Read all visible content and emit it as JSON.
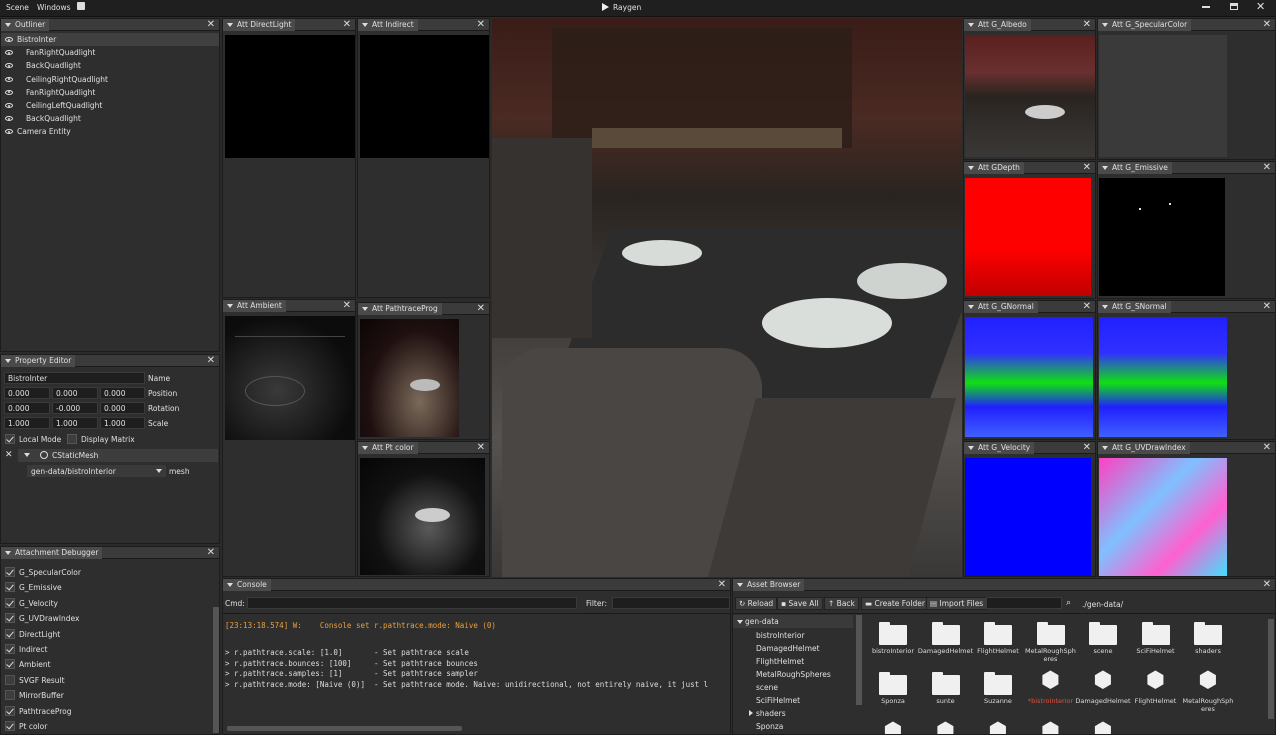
{
  "menu": {
    "scene": "Scene",
    "windows": "Windows",
    "save_icon": "save-icon",
    "run_label": "Raygen"
  },
  "outliner": {
    "title": "Outliner",
    "items": [
      {
        "label": "BistroInter",
        "indent": false,
        "selected": true
      },
      {
        "label": "FanRightQuadlight",
        "indent": true
      },
      {
        "label": "BackQuadlight",
        "indent": true
      },
      {
        "label": "CeilingRightQuadlight",
        "indent": true
      },
      {
        "label": "FanRightQuadlight",
        "indent": true
      },
      {
        "label": "CeilingLeftQuadlight",
        "indent": true
      },
      {
        "label": "BackQuadlight",
        "indent": true
      },
      {
        "label": "Camera Entity",
        "indent": false
      }
    ]
  },
  "property_editor": {
    "title": "Property Editor",
    "name_value": "BistroInter",
    "name_label": "Name",
    "position": [
      "0.000",
      "0.000",
      "0.000"
    ],
    "position_label": "Position",
    "rotation": [
      "0.000",
      "-0.000",
      "0.000"
    ],
    "rotation_label": "Rotation",
    "scale": [
      "1.000",
      "1.000",
      "1.000"
    ],
    "scale_label": "Scale",
    "local_mode": "Local Mode",
    "display_matrix": "Display Matrix",
    "component": "CStaticMesh",
    "mesh_value": "gen-data/bistroInterior",
    "mesh_label": "mesh"
  },
  "attachment_debugger": {
    "title": "Attachment Debugger",
    "items": [
      {
        "label": "G_SpecularColor",
        "checked": true
      },
      {
        "label": "G_Emissive",
        "checked": true
      },
      {
        "label": "G_Velocity",
        "checked": true
      },
      {
        "label": "G_UVDrawIndex",
        "checked": true
      },
      {
        "label": "DirectLight",
        "checked": true
      },
      {
        "label": "Indirect",
        "checked": true
      },
      {
        "label": "Ambient",
        "checked": true
      },
      {
        "label": "SVGF Result",
        "checked": false
      },
      {
        "label": "MirrorBuffer",
        "checked": false
      },
      {
        "label": "PathtraceProg",
        "checked": true
      },
      {
        "label": "Pt color",
        "checked": true
      }
    ]
  },
  "att_panels": {
    "direct_light": "Att DirectLight",
    "indirect": "Att Indirect",
    "ambient": "Att Ambient",
    "pathtrace_prog": "Att PathtraceProg",
    "pt_color": "Att Pt color",
    "albedo": "Att G_Albedo",
    "specular": "Att G_SpecularColor",
    "depth": "Att GDepth",
    "emissive": "Att G_Emissive",
    "gnormal": "Att G_GNormal",
    "snormal": "Att G_SNormal",
    "velocity": "Att G_Velocity",
    "uvdraw": "Att G_UVDrawIndex"
  },
  "console": {
    "title": "Console",
    "cmd_label": "Cmd:",
    "filter_label": "Filter:",
    "lines": [
      {
        "text": "[23:13:18.574] W:    Console set r.pathtrace.mode: Naive (0)",
        "color": "#e8a040"
      },
      {
        "text": "",
        "color": "#ddd"
      },
      {
        "text": "> r.pathtrace.scale: [1.0]       - Set pathtrace scale",
        "color": "#ddd"
      },
      {
        "text": "> r.pathtrace.bounces: [100]     - Set pathtrace bounces",
        "color": "#ddd"
      },
      {
        "text": "> r.pathtrace.samples: [1]       - Set pathtrace sampler",
        "color": "#ddd"
      },
      {
        "text": "> r.pathtrace.mode: [Naive (0)]  - Set pathtrace mode. Naive: unidirectional, not entirely naive, it just l",
        "color": "#ddd"
      }
    ]
  },
  "asset_browser": {
    "title": "Asset Browser",
    "reload": "Reload",
    "save_all": "Save All",
    "back": "Back",
    "create_folder": "Create Folder",
    "import_files": "Import Files",
    "path": "./gen-data/",
    "tree_root": "gen-data",
    "tree": [
      "bistroInterior",
      "DamagedHelmet",
      "FlightHelmet",
      "MetalRoughSpheres",
      "scene",
      "SciFiHelmet",
      "shaders",
      "Sponza"
    ],
    "grid": [
      {
        "label": "bistroInterior",
        "kind": "folder",
        "highlight": false
      },
      {
        "label": "DamagedHelmet",
        "kind": "folder",
        "highlight": false
      },
      {
        "label": "FlightHelmet",
        "kind": "folder",
        "highlight": false
      },
      {
        "label": "MetalRoughSph eres",
        "kind": "folder",
        "highlight": false
      },
      {
        "label": "scene",
        "kind": "folder",
        "highlight": false
      },
      {
        "label": "SciFiHelmet",
        "kind": "folder",
        "highlight": false
      },
      {
        "label": "shaders",
        "kind": "folder",
        "highlight": false
      },
      {
        "label": "Sponza",
        "kind": "folder",
        "highlight": false
      },
      {
        "label": "sunte",
        "kind": "folder",
        "highlight": false
      },
      {
        "label": "Suzanne",
        "kind": "folder",
        "highlight": false
      },
      {
        "label": "*bistroInterior",
        "kind": "cube",
        "highlight": true
      },
      {
        "label": "DamagedHelmet",
        "kind": "cube",
        "highlight": false
      },
      {
        "label": "FlightHelmet",
        "kind": "cube",
        "highlight": false
      },
      {
        "label": "MetalRoughSph eres",
        "kind": "cube",
        "highlight": false
      }
    ],
    "highlight_color": "#e05040"
  },
  "colors": {
    "depth": "#ff0000",
    "velocity": "#0000ff",
    "normal_green": "#10e010",
    "normal_blue": "#2020ff",
    "uv_pink": "#ff40c0"
  }
}
